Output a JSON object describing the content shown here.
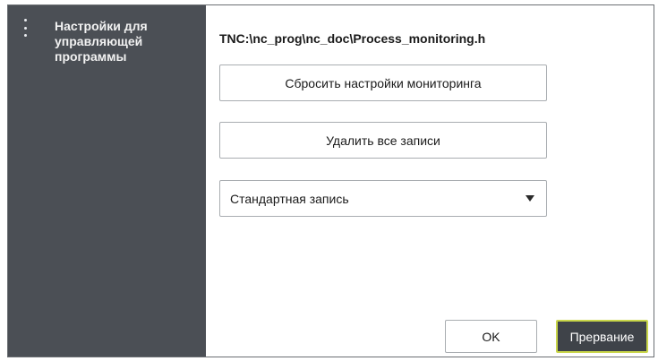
{
  "sidebar": {
    "menu_icon": "kebab-menu-icon",
    "title": "Настройки для\nуправляющей\nпрограммы"
  },
  "main": {
    "file_path": "TNC:\\nc_prog\\nc_doc\\Process_monitoring.h",
    "reset_button_label": "Сбросить настройки мониторинга",
    "delete_button_label": "Удалить все записи",
    "record_select": {
      "value": "Стандартная запись",
      "icon": "caret-down-icon"
    }
  },
  "footer": {
    "ok_label": "OK",
    "cancel_label": "Прервание"
  },
  "colors": {
    "sidebar_bg": "#4b4f55",
    "cancel_bg": "#3f4349",
    "focus_accent": "#c9d64a"
  }
}
